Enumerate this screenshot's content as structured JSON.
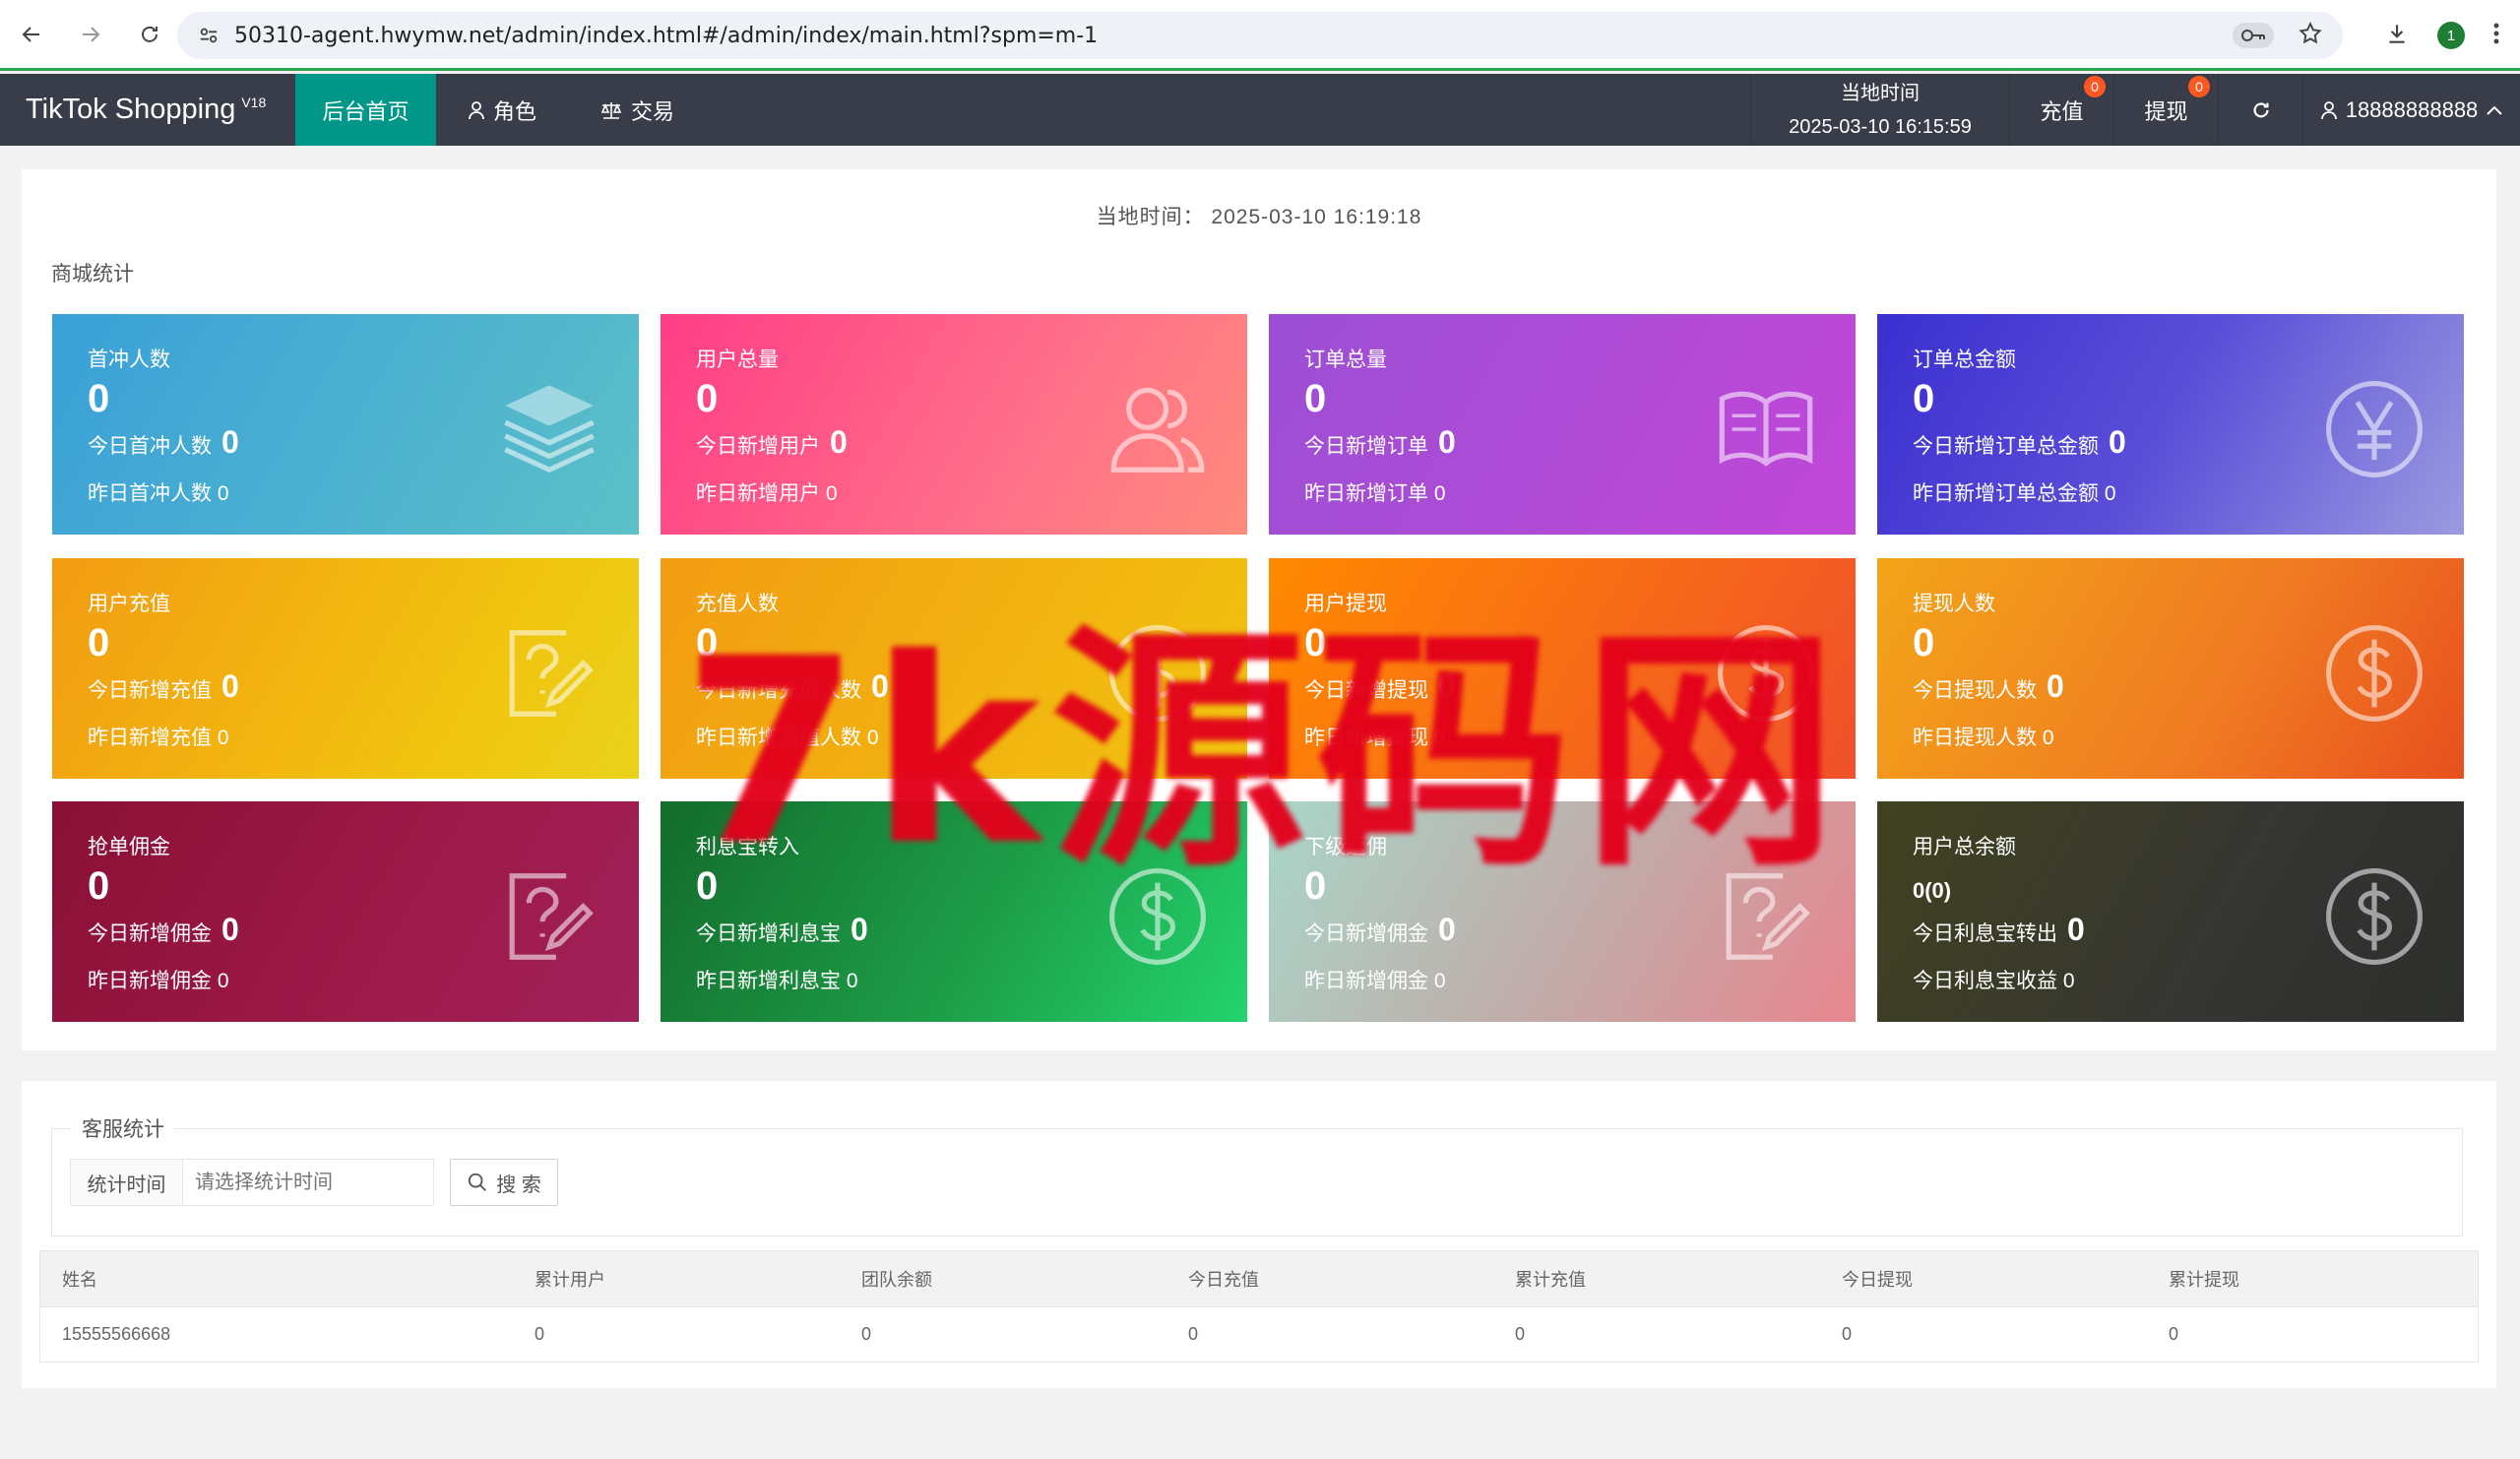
{
  "browser": {
    "url": "50310-agent.hwymw.net/admin/index.html#/admin/index/main.html?spm=m-1",
    "profile_initial": "1"
  },
  "header": {
    "logo": "TikTok Shopping",
    "version": "V18",
    "nav": [
      {
        "label": "后台首页"
      },
      {
        "label": "角色"
      },
      {
        "label": "交易"
      }
    ],
    "clock_label": "当地时间",
    "clock_value": "2025-03-10 16:15:59",
    "recharge_label": "充值",
    "recharge_badge": "0",
    "withdraw_label": "提现",
    "withdraw_badge": "0",
    "user": "18888888888"
  },
  "main": {
    "local_time_label": "当地时间：",
    "local_time_value": "2025-03-10 16:19:18",
    "section_title": "商城统计",
    "cards": [
      {
        "title": "首冲人数",
        "value": "0",
        "today_label": "今日首冲人数",
        "today": "0",
        "yest_label": "昨日首冲人数",
        "yest": "0",
        "icon": "layers-icon"
      },
      {
        "title": "用户总量",
        "value": "0",
        "today_label": "今日新增用户",
        "today": "0",
        "yest_label": "昨日新增用户",
        "yest": "0",
        "icon": "users-icon"
      },
      {
        "title": "订单总量",
        "value": "0",
        "today_label": "今日新增订单",
        "today": "0",
        "yest_label": "昨日新增订单",
        "yest": "0",
        "icon": "book-icon"
      },
      {
        "title": "订单总金额",
        "value": "0",
        "today_label": "今日新增订单总金额",
        "today": "0",
        "yest_label": "昨日新增订单总金额",
        "yest": "0",
        "icon": "yen-icon"
      },
      {
        "title": "用户充值",
        "value": "0",
        "today_label": "今日新增充值",
        "today": "0",
        "yest_label": "昨日新增充值",
        "yest": "0",
        "icon": "question-edit-icon"
      },
      {
        "title": "充值人数",
        "value": "0",
        "today_label": "今日新增充值人数",
        "today": "0",
        "yest_label": "昨日新增充值人数",
        "yest": "0",
        "icon": "dollar-icon"
      },
      {
        "title": "用户提现",
        "value": "0",
        "today_label": "今日新增提现",
        "today": "0",
        "yest_label": "昨日新增提现",
        "yest": "0",
        "icon": "dollar-icon"
      },
      {
        "title": "提现人数",
        "value": "0",
        "today_label": "今日提现人数",
        "today": "0",
        "yest_label": "昨日提现人数",
        "yest": "0",
        "icon": "dollar-icon"
      },
      {
        "title": "抢单佣金",
        "value": "0",
        "today_label": "今日新增佣金",
        "today": "0",
        "yest_label": "昨日新增佣金",
        "yest": "0",
        "icon": "question-edit-icon"
      },
      {
        "title": "利息宝转入",
        "value": "0",
        "today_label": "今日新增利息宝",
        "today": "0",
        "yest_label": "昨日新增利息宝",
        "yest": "0",
        "icon": "dollar-icon"
      },
      {
        "title": "下级返佣",
        "value": "0",
        "today_label": "今日新增佣金",
        "today": "0",
        "yest_label": "昨日新增佣金",
        "yest": "0",
        "icon": "question-edit-icon"
      },
      {
        "title": "用户总余额",
        "value": "0(0)",
        "today_label": "今日利息宝转出",
        "today": "0",
        "yest_label": "今日利息宝收益",
        "yest": "0",
        "icon": "dollar-icon"
      }
    ],
    "watermark": "7k源码网"
  },
  "service": {
    "legend": "客服统计",
    "time_label": "统计时间",
    "time_placeholder": "请选择统计时间",
    "search_label": "搜 索",
    "columns": [
      "姓名",
      "累计用户",
      "团队余额",
      "今日充值",
      "累计充值",
      "今日提现",
      "累计提现"
    ],
    "rows": [
      [
        "15555566668",
        "0",
        "0",
        "0",
        "0",
        "0",
        "0"
      ]
    ]
  }
}
